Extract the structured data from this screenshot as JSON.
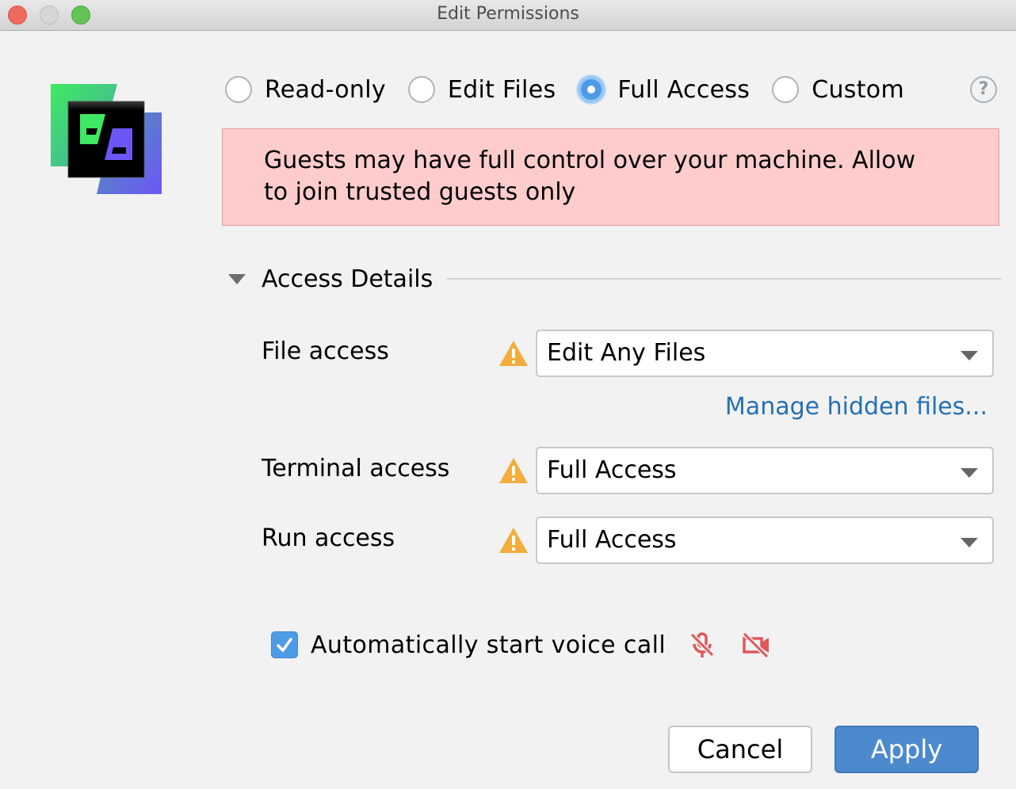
{
  "window": {
    "title": "Edit Permissions",
    "controls": [
      "close",
      "minimize",
      "maximize"
    ]
  },
  "logo": {
    "icon": "code-with-me-logo-icon"
  },
  "access_modes": {
    "options": [
      {
        "label": "Read-only",
        "selected": false
      },
      {
        "label": "Edit Files",
        "selected": false
      },
      {
        "label": "Full Access",
        "selected": true
      },
      {
        "label": "Custom",
        "selected": false
      }
    ],
    "help_icon": "?"
  },
  "warning_banner": {
    "line1": "Guests may have full control over your machine. Allow",
    "line2": "to join trusted guests only",
    "background": "#ffcccc"
  },
  "access_details": {
    "title": "Access Details",
    "expanded": true,
    "rows": [
      {
        "label": "File access",
        "value": "Edit Any Files",
        "warning": true
      },
      {
        "label": "Terminal access",
        "value": "Full Access",
        "warning": true
      },
      {
        "label": "Run access",
        "value": "Full Access",
        "warning": true
      }
    ],
    "manage_link": "Manage hidden files..."
  },
  "voice_call": {
    "label": "Automatically start voice call",
    "checked": true,
    "icons": [
      "microphone-off-icon",
      "camera-off-icon"
    ],
    "icon_color": "#e0575b"
  },
  "buttons": {
    "cancel": "Cancel",
    "apply": "Apply"
  },
  "colors": {
    "accent": "#4d9be6",
    "apply_button": "#4d8acd",
    "link": "#2470b3",
    "warning_icon": "#f4ac3c"
  }
}
